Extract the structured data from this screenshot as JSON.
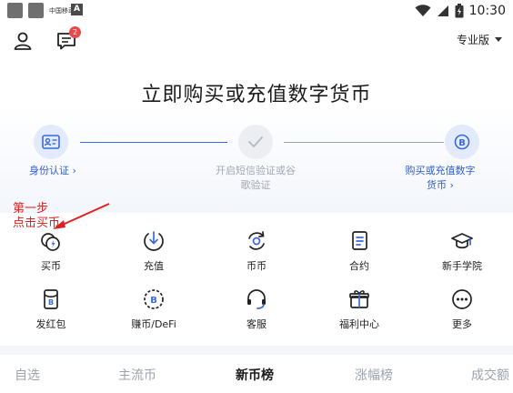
{
  "status_bar": {
    "carrier_text": "中国移动",
    "a_label": "A",
    "time": "10:30"
  },
  "topbar": {
    "badge_count": "2",
    "mode": "专业版"
  },
  "hero": {
    "title": "立即购买或充值数字货币",
    "steps": [
      {
        "label_line1": "身份认证 ›",
        "label_line2": ""
      },
      {
        "label_line1": "开启短信验证或谷",
        "label_line2": "歌验证"
      },
      {
        "label_line1": "购买或充值数字",
        "label_line2": "货币 ›"
      }
    ]
  },
  "grid": {
    "items": [
      {
        "label": "买币",
        "icon": "buy-coin-icon"
      },
      {
        "label": "充值",
        "icon": "deposit-icon"
      },
      {
        "label": "币币",
        "icon": "exchange-icon"
      },
      {
        "label": "合约",
        "icon": "contract-icon"
      },
      {
        "label": "新手学院",
        "icon": "academy-icon"
      },
      {
        "label": "发红包",
        "icon": "red-packet-icon"
      },
      {
        "label": "赚币/DeFi",
        "icon": "earn-icon"
      },
      {
        "label": "客服",
        "icon": "headset-icon"
      },
      {
        "label": "福利中心",
        "icon": "gift-icon"
      },
      {
        "label": "更多",
        "icon": "more-icon"
      }
    ]
  },
  "annotation": {
    "line1": "第一步",
    "line2": "点击买币"
  },
  "tabs": [
    {
      "label": "自选"
    },
    {
      "label": "主流币"
    },
    {
      "label": "新币榜"
    },
    {
      "label": "涨幅榜"
    },
    {
      "label": "成交额"
    }
  ],
  "colors": {
    "accent_blue": "#3a6bd8",
    "badge_red": "#e8484b",
    "annotation_red": "#e02020"
  }
}
